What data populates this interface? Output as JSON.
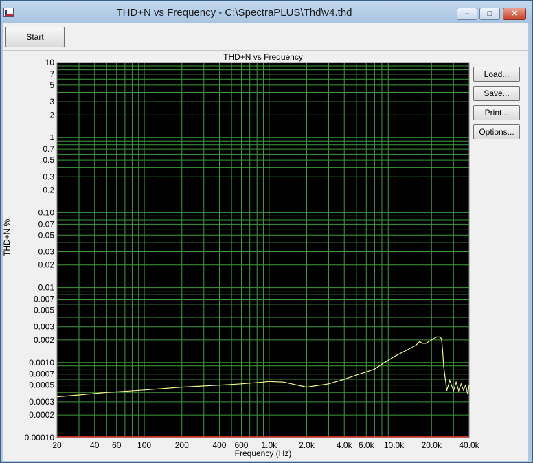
{
  "window": {
    "title": "THD+N vs Frequency - C:\\SpectraPLUS\\Thd\\v4.thd"
  },
  "titlebar_buttons": {
    "minimize": "–",
    "maximize": "□",
    "close": "✕"
  },
  "toolbar": {
    "start_label": "Start"
  },
  "side_buttons": {
    "load": "Load...",
    "save": "Save...",
    "print": "Print...",
    "options": "Options..."
  },
  "colors": {
    "plot_bg": "#000000",
    "grid": "#3f9a3f",
    "trace": "#f5f58a",
    "baseline": "#ff3a2a"
  },
  "chart_data": {
    "type": "line",
    "title": "THD+N vs Frequency",
    "xlabel": "Frequency (Hz)",
    "ylabel": "THD+N %",
    "xscale": "log",
    "yscale": "log",
    "xlim": [
      20,
      40000
    ],
    "ylim": [
      0.001,
      10
    ],
    "grid": true,
    "x_ticks": [
      {
        "v": 20,
        "label": "20"
      },
      {
        "v": 40,
        "label": "40"
      },
      {
        "v": 60,
        "label": "60"
      },
      {
        "v": 100,
        "label": "100"
      },
      {
        "v": 200,
        "label": "200"
      },
      {
        "v": 400,
        "label": "400"
      },
      {
        "v": 600,
        "label": "600"
      },
      {
        "v": 1000,
        "label": "1.0k"
      },
      {
        "v": 2000,
        "label": "2.0k"
      },
      {
        "v": 4000,
        "label": "4.0k"
      },
      {
        "v": 6000,
        "label": "6.0k"
      },
      {
        "v": 10000,
        "label": "10.0k"
      },
      {
        "v": 20000,
        "label": "20.0k"
      },
      {
        "v": 40000,
        "label": "40.0k"
      }
    ],
    "y_ticks": [
      {
        "v": 10,
        "label": "10"
      },
      {
        "v": 7,
        "label": "7"
      },
      {
        "v": 5,
        "label": "5"
      },
      {
        "v": 3,
        "label": "3"
      },
      {
        "v": 2,
        "label": "2"
      },
      {
        "v": 1,
        "label": "1"
      },
      {
        "v": 0.7,
        "label": "0.7"
      },
      {
        "v": 0.5,
        "label": "0.5"
      },
      {
        "v": 0.3,
        "label": "0.3"
      },
      {
        "v": 0.2,
        "label": "0.2"
      },
      {
        "v": 0.1,
        "label": "0.10"
      },
      {
        "v": 0.07,
        "label": "0.07"
      },
      {
        "v": 0.05,
        "label": "0.05"
      },
      {
        "v": 0.03,
        "label": "0.03"
      },
      {
        "v": 0.02,
        "label": "0.02"
      },
      {
        "v": 0.01,
        "label": "0.01"
      },
      {
        "v": 0.007,
        "label": "0.007"
      },
      {
        "v": 0.005,
        "label": "0.005"
      },
      {
        "v": 0.003,
        "label": "0.003"
      },
      {
        "v": 0.002,
        "label": "0.002"
      },
      {
        "v": 0.001,
        "label": "0.0010"
      },
      {
        "v": 0.0007,
        "label": "0.0007"
      },
      {
        "v": 0.0005,
        "label": "0.0005"
      },
      {
        "v": 0.0003,
        "label": "0.0003"
      },
      {
        "v": 0.0002,
        "label": "0.0002"
      },
      {
        "v": 0.0001,
        "label": "0.00010"
      }
    ],
    "series": [
      {
        "x": [
          20,
          30,
          50,
          100,
          200,
          400,
          600,
          900,
          1000,
          1300,
          2000,
          3000,
          4000,
          5000,
          6000,
          7000,
          8000,
          10000,
          12000,
          14000,
          15000,
          16000,
          17000,
          18000,
          19000,
          20000,
          21000,
          22000,
          23000,
          24000,
          24500,
          25000,
          26500,
          28000,
          30000,
          31500,
          33000,
          34500,
          36000,
          37500,
          39000,
          40000
        ],
        "values": [
          0.00035,
          0.00037,
          0.0004,
          0.00043,
          0.00047,
          0.0005,
          0.00052,
          0.00055,
          0.00056,
          0.00055,
          0.00047,
          0.00052,
          0.0006,
          0.00068,
          0.00075,
          0.00082,
          0.00095,
          0.0012,
          0.0014,
          0.0016,
          0.0017,
          0.0019,
          0.0018,
          0.0018,
          0.0019,
          0.002,
          0.0021,
          0.0022,
          0.0022,
          0.0021,
          0.0015,
          0.0009,
          0.00042,
          0.00058,
          0.00042,
          0.00055,
          0.00042,
          0.00052,
          0.00043,
          0.0005,
          0.00038,
          0.0005
        ]
      }
    ]
  }
}
